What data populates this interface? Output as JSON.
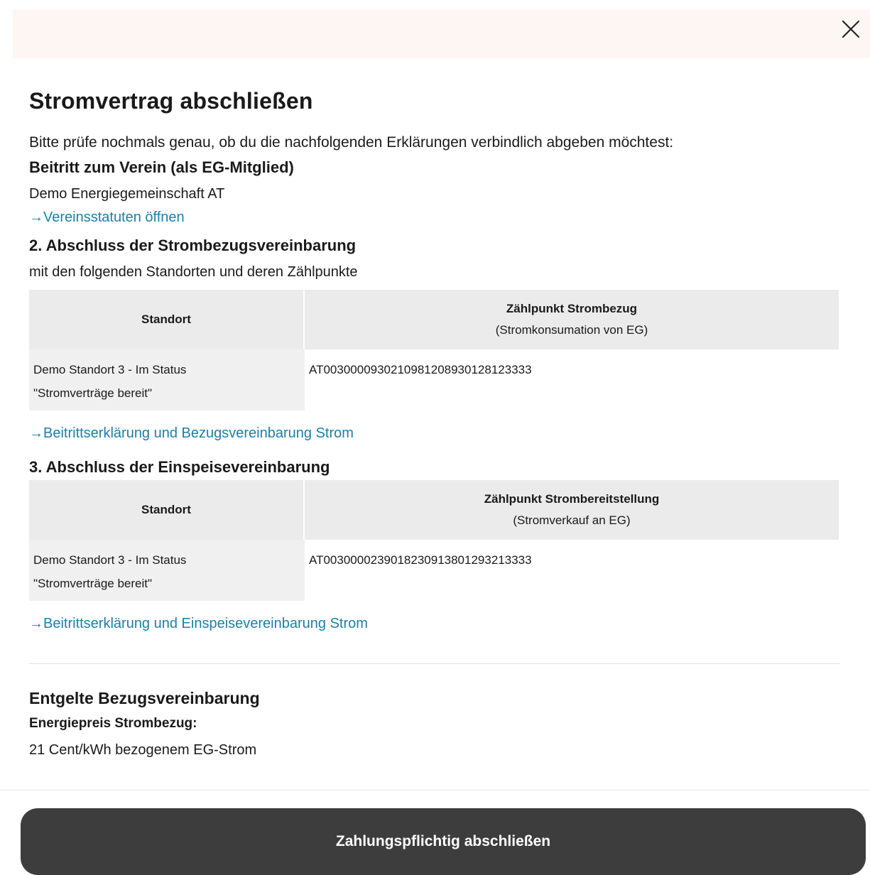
{
  "dialog": {
    "title": "Stromvertrag abschließen",
    "close_icon": "close-icon"
  },
  "intro": "Bitte prüfe nochmals genau, ob du die nachfolgenden Erklärungen verbindlich abgeben möchtest:",
  "section1": {
    "heading": "Beitritt zum Verein (als EG-Mitglied)",
    "org": "Demo Energiegemeinschaft AT",
    "link": "→Vereinsstatuten öffnen"
  },
  "section2": {
    "heading": "2. Abschluss der Strombezugsvereinbarung",
    "subtitle": "mit den folgenden Standorten und deren Zählpunkte",
    "table": {
      "col1": "Standort",
      "col2_title": "Zählpunkt Strombezug",
      "col2_sub": "(Stromkonsumation von EG)",
      "rows": [
        {
          "standort_line1": "Demo Standort 3 - Im Status",
          "standort_line2": "\"Stromverträge bereit\"",
          "zaehlpunkt": "AT0030000930210981208930128123333"
        }
      ]
    },
    "link": "→Beitrittserklärung und Bezugsvereinbarung Strom"
  },
  "section3": {
    "heading": "3. Abschluss der Einspeisevereinbarung",
    "table": {
      "col1": "Standort",
      "col2_title": "Zählpunkt Strombereitstellung",
      "col2_sub": "(Stromverkauf an EG)",
      "rows": [
        {
          "standort_line1": "Demo Standort 3 - Im Status",
          "standort_line2": "\"Stromverträge bereit\"",
          "zaehlpunkt": "AT0030000239018230913801293213333"
        }
      ]
    },
    "link": "→Beitrittserklärung und Einspeisevereinbarung Strom"
  },
  "pricing": {
    "heading": "Entgelte Bezugsvereinbarung",
    "label": "Energiepreis Strombezug:",
    "value": "21 Cent/kWh bezogenem EG-Strom"
  },
  "cta": {
    "label": "Zahlungspflichtig abschließen"
  },
  "colors": {
    "accent_link": "#1b7fa6",
    "button_bg": "#3d3d3d",
    "header_bg": "#fdf6f2"
  }
}
